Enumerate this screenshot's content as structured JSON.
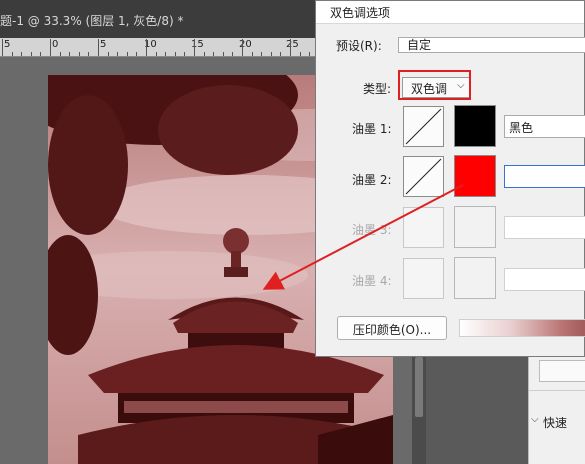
{
  "document": {
    "tab_title": "题-1 @ 33.3% (图层 1, 灰色/8) *",
    "ruler_labels": [
      "5",
      "0",
      "5",
      "10",
      "15",
      "20",
      "25"
    ]
  },
  "dialog": {
    "title": "双色调选项",
    "preset_label": "预设(R):",
    "preset_value": "自定",
    "type_label": "类型:",
    "type_value": "双色调",
    "inks": [
      {
        "label": "油墨 1:",
        "color": "#000000",
        "name": "黑色",
        "enabled": true
      },
      {
        "label": "油墨 2:",
        "color": "#ff0000",
        "name": "",
        "enabled": true
      },
      {
        "label": "油墨 3:",
        "color": "#f2f2f2",
        "name": "",
        "enabled": false
      },
      {
        "label": "油墨 4:",
        "color": "#f2f2f2",
        "name": "",
        "enabled": false
      }
    ],
    "overprint_button": "压印颜色(O)..."
  },
  "side_panel": {
    "section_label": "快速"
  },
  "colors": {
    "highlight": "#e02020",
    "duotone_tint": "#a05858"
  }
}
